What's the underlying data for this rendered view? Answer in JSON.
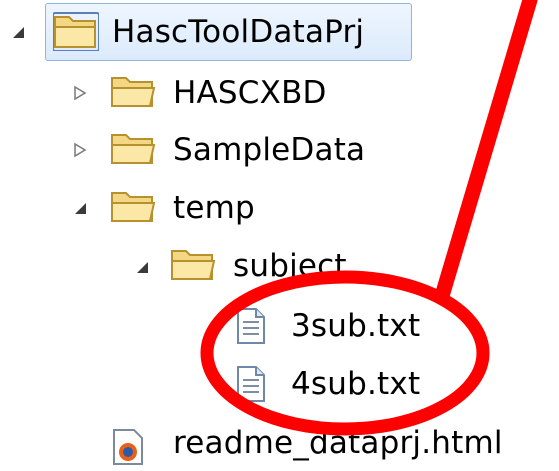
{
  "tree": {
    "items": [
      {
        "label": "HascToolDataPrj",
        "expanded": true,
        "icon": "project-folder-icon",
        "selected": true
      },
      {
        "label": "HASCXBD",
        "expanded": false,
        "icon": "folder-icon"
      },
      {
        "label": "SampleData",
        "expanded": false,
        "icon": "folder-icon"
      },
      {
        "label": "temp",
        "expanded": true,
        "icon": "folder-icon"
      },
      {
        "label": "subject",
        "expanded": true,
        "icon": "folder-icon"
      },
      {
        "label": "3sub.txt",
        "icon": "text-file-icon"
      },
      {
        "label": "4sub.txt",
        "icon": "text-file-icon"
      },
      {
        "label": "readme_dataprj.html",
        "icon": "html-file-icon"
      }
    ]
  },
  "annotation": {
    "color": "#ff0000"
  }
}
